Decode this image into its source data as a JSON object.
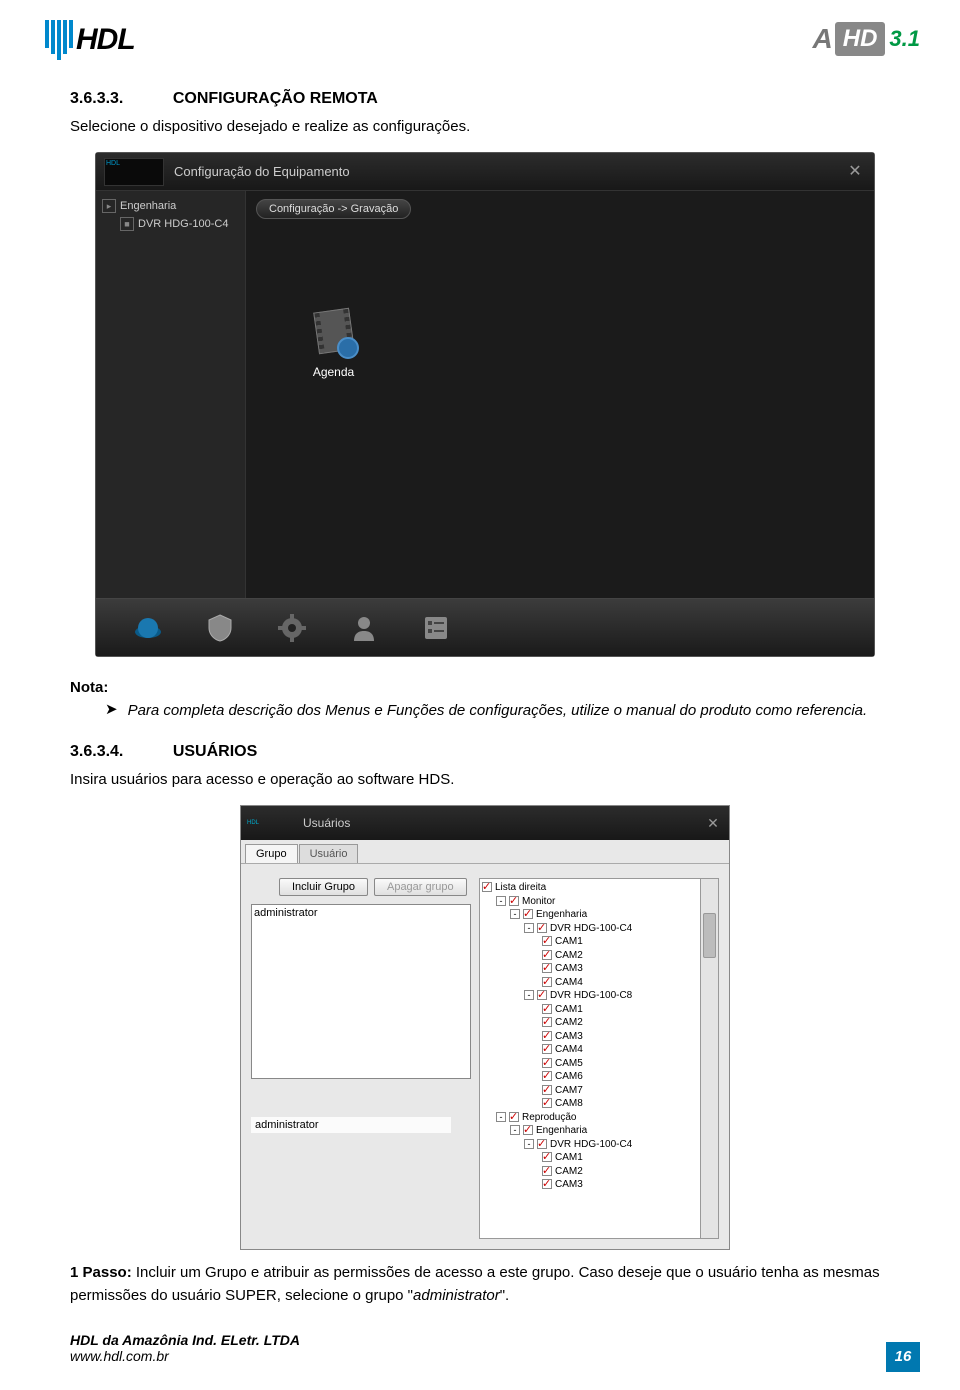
{
  "header": {
    "logo_text": "HDL",
    "logo_right_a": "A",
    "logo_right_hd": "HD",
    "logo_right_ver": "3.1"
  },
  "section1": {
    "num": "3.6.3.3.",
    "title": "CONFIGURAÇÃO REMOTA",
    "text": "Selecione o dispositivo desejado e realize as configurações."
  },
  "shot1": {
    "title": "Configuração do Equipamento",
    "close": "✕",
    "tree_root": "Engenharia",
    "tree_child": "DVR HDG-100-C4",
    "breadcrumb": "Configuração -> Gravação",
    "agenda_label": "Agenda"
  },
  "note": {
    "label": "Nota:",
    "text": "Para completa descrição dos Menus e Funções de configurações, utilize o manual do produto como referencia."
  },
  "section2": {
    "num": "3.6.3.4.",
    "title": "USUÁRIOS",
    "text": "Insira usuários para acesso e operação ao software HDS."
  },
  "shot2": {
    "title": "Usuários",
    "close": "✕",
    "tab1": "Grupo",
    "tab2": "Usuário",
    "btn_add": "Incluir Grupo",
    "btn_del": "Apagar grupo",
    "list_item": "administrator",
    "entry_value": "administrator",
    "perm": {
      "root": "Lista direita",
      "monitor": "Monitor",
      "eng": "Engenharia",
      "dvr1": "DVR HDG-100-C4",
      "dvr2": "DVR HDG-100-C8",
      "cam1": "CAM1",
      "cam2": "CAM2",
      "cam3": "CAM3",
      "cam4": "CAM4",
      "cam5": "CAM5",
      "cam6": "CAM6",
      "cam7": "CAM7",
      "cam8": "CAM8",
      "repro": "Reprodução"
    }
  },
  "passo": {
    "label": "1 Passo:",
    "text1": " Incluir um Grupo e atribuir as permissões de acesso a este grupo. Caso deseje que o usuário tenha as mesmas permissões do usuário SUPER, selecione o grupo \"",
    "admin": "administrator",
    "text2": "\"."
  },
  "footer": {
    "line1": "HDL da Amazônia Ind. ELetr. LTDA",
    "line2": "www.hdl.com.br",
    "page": "16"
  }
}
